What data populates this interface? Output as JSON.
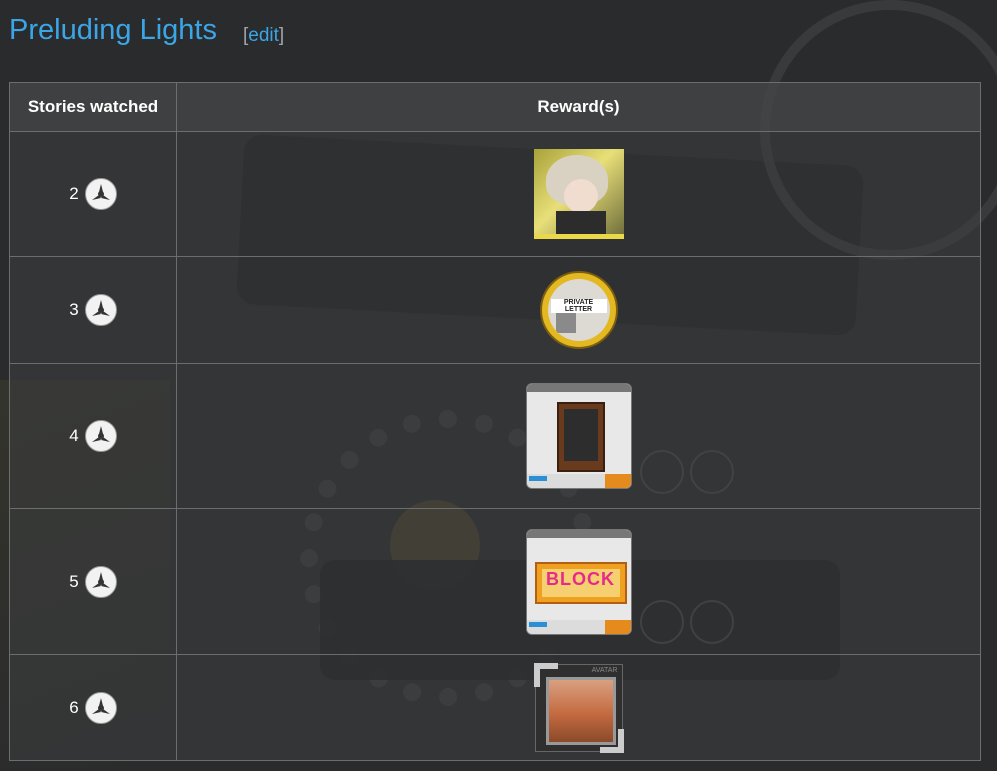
{
  "page": {
    "title": "Preluding Lights",
    "edit_label": "edit",
    "edit_open": "[",
    "edit_close": "]"
  },
  "table": {
    "headers": [
      "Stories watched",
      "Reward(s)"
    ],
    "rows": [
      {
        "count": "2",
        "reward_icon": "operator-portrait-icon"
      },
      {
        "count": "3",
        "reward_icon": "private-letter-medal-icon"
      },
      {
        "count": "4",
        "reward_icon": "furniture-cabinet-card-icon"
      },
      {
        "count": "5",
        "reward_icon": "block-sign-furniture-card-icon"
      },
      {
        "count": "6",
        "reward_icon": "avatar-frame-icon"
      }
    ]
  },
  "assets": {
    "block_sign_text": "BLOCK",
    "coin_label": "PRIVATE LETTER",
    "avatar_tag": "AVATAR"
  },
  "colors": {
    "title": "#3aa6e8",
    "link": "#3aa6e8",
    "border": "#6b6d70"
  }
}
